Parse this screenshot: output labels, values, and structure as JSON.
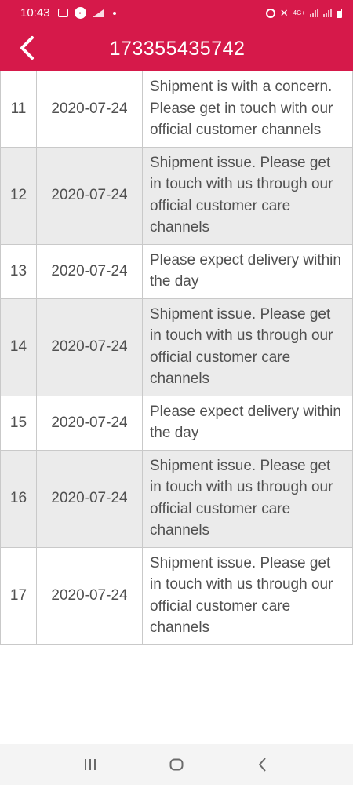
{
  "status_bar": {
    "time": "10:43",
    "network_label": "4G+",
    "accent_color": "#d6194a"
  },
  "header": {
    "back_icon": "chevron-left-icon",
    "title": "173355435742"
  },
  "tracking_rows": [
    {
      "no": "11",
      "date": "2020-07-24",
      "message": "Shipment is with a concern. Please get in touch with our official customer channels"
    },
    {
      "no": "12",
      "date": "2020-07-24",
      "message": "Shipment issue. Please get in touch with us through our official customer care channels"
    },
    {
      "no": "13",
      "date": "2020-07-24",
      "message": "Please expect delivery within the day"
    },
    {
      "no": "14",
      "date": "2020-07-24",
      "message": "Shipment issue. Please get in touch with us through our official customer care channels"
    },
    {
      "no": "15",
      "date": "2020-07-24",
      "message": "Please expect delivery within the day"
    },
    {
      "no": "16",
      "date": "2020-07-24",
      "message": "Shipment issue. Please get in touch with us through our official customer care channels"
    },
    {
      "no": "17",
      "date": "2020-07-24",
      "message": "Shipment issue. Please get in touch with us through our official customer care channels"
    }
  ],
  "nav_bar": {
    "recents_icon": "recents-icon",
    "home_icon": "home-icon",
    "back_icon": "back-icon"
  }
}
